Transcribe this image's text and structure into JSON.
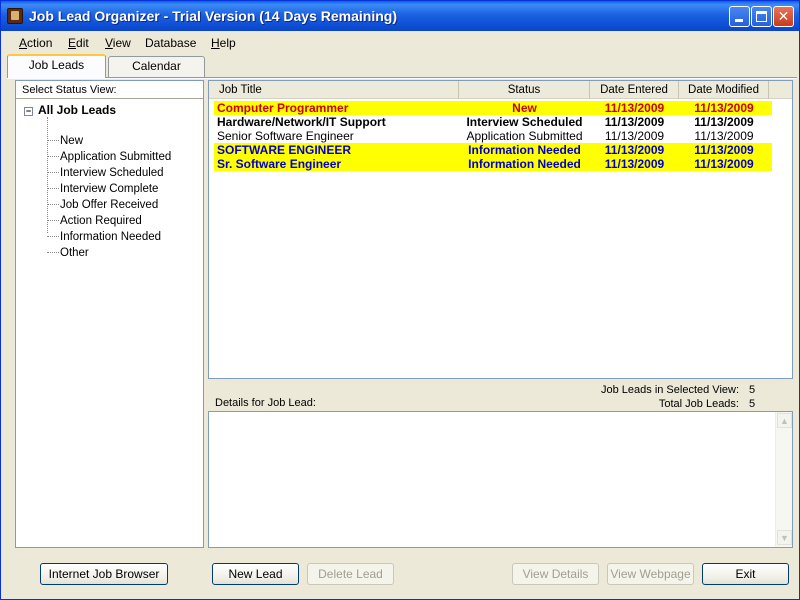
{
  "window": {
    "title": "Job Lead Organizer - Trial Version (14 Days Remaining)",
    "controls": {
      "minimize": "",
      "maximize": "",
      "close": "✕"
    }
  },
  "menu": [
    {
      "accel": "A",
      "rest": "ction"
    },
    {
      "accel": "E",
      "rest": "dit"
    },
    {
      "accel": "V",
      "rest": "iew"
    },
    {
      "accel": "",
      "rest": "Database"
    },
    {
      "accel": "H",
      "rest": "elp"
    }
  ],
  "tabs": {
    "job_leads": "Job Leads",
    "calendar": "Calendar"
  },
  "status_view": {
    "header": "Select Status View:",
    "root": "All Job Leads",
    "expander": "−",
    "items": [
      "New",
      "Application Submitted",
      "Interview Scheduled",
      "Interview Complete",
      "Job Offer Received",
      "Action Required",
      "Information Needed",
      "Other"
    ]
  },
  "grid": {
    "columns": {
      "title": "Job Title",
      "status": "Status",
      "entered": "Date Entered",
      "modified": "Date Modified"
    },
    "rows": [
      {
        "title": "Computer Programmer",
        "status": "New",
        "entered": "11/13/2009",
        "modified": "11/13/2009",
        "highlight": true,
        "color": "#CC0000",
        "bold": true
      },
      {
        "title": "Hardware/Network/IT Support",
        "status": "Interview Scheduled",
        "entered": "11/13/2009",
        "modified": "11/13/2009",
        "highlight": false,
        "color": "#000000",
        "bold": true
      },
      {
        "title": "Senior Software Engineer",
        "status": "Application Submitted",
        "entered": "11/13/2009",
        "modified": "11/13/2009",
        "highlight": false,
        "color": "#000000",
        "bold": false
      },
      {
        "title": "SOFTWARE ENGINEER",
        "status": "Information Needed",
        "entered": "11/13/2009",
        "modified": "11/13/2009",
        "highlight": true,
        "color": "#0000CC",
        "bold": true
      },
      {
        "title": "Sr. Software Engineer",
        "status": "Information Needed",
        "entered": "11/13/2009",
        "modified": "11/13/2009",
        "highlight": true,
        "color": "#0000CC",
        "bold": true
      }
    ]
  },
  "counts": {
    "selected_label": "Job Leads in Selected View:",
    "selected_value": "5",
    "total_label": "Total Job Leads:",
    "total_value": "5"
  },
  "details": {
    "label": "Details for Job Lead:",
    "value": ""
  },
  "scroll": {
    "up": "▲",
    "down": "▼"
  },
  "buttons": {
    "browser": "Internet Job Browser",
    "new_lead": "New Lead",
    "delete_lead": "Delete Lead",
    "view_details": "View Details",
    "view_webpage": "View Webpage",
    "exit": "Exit"
  }
}
